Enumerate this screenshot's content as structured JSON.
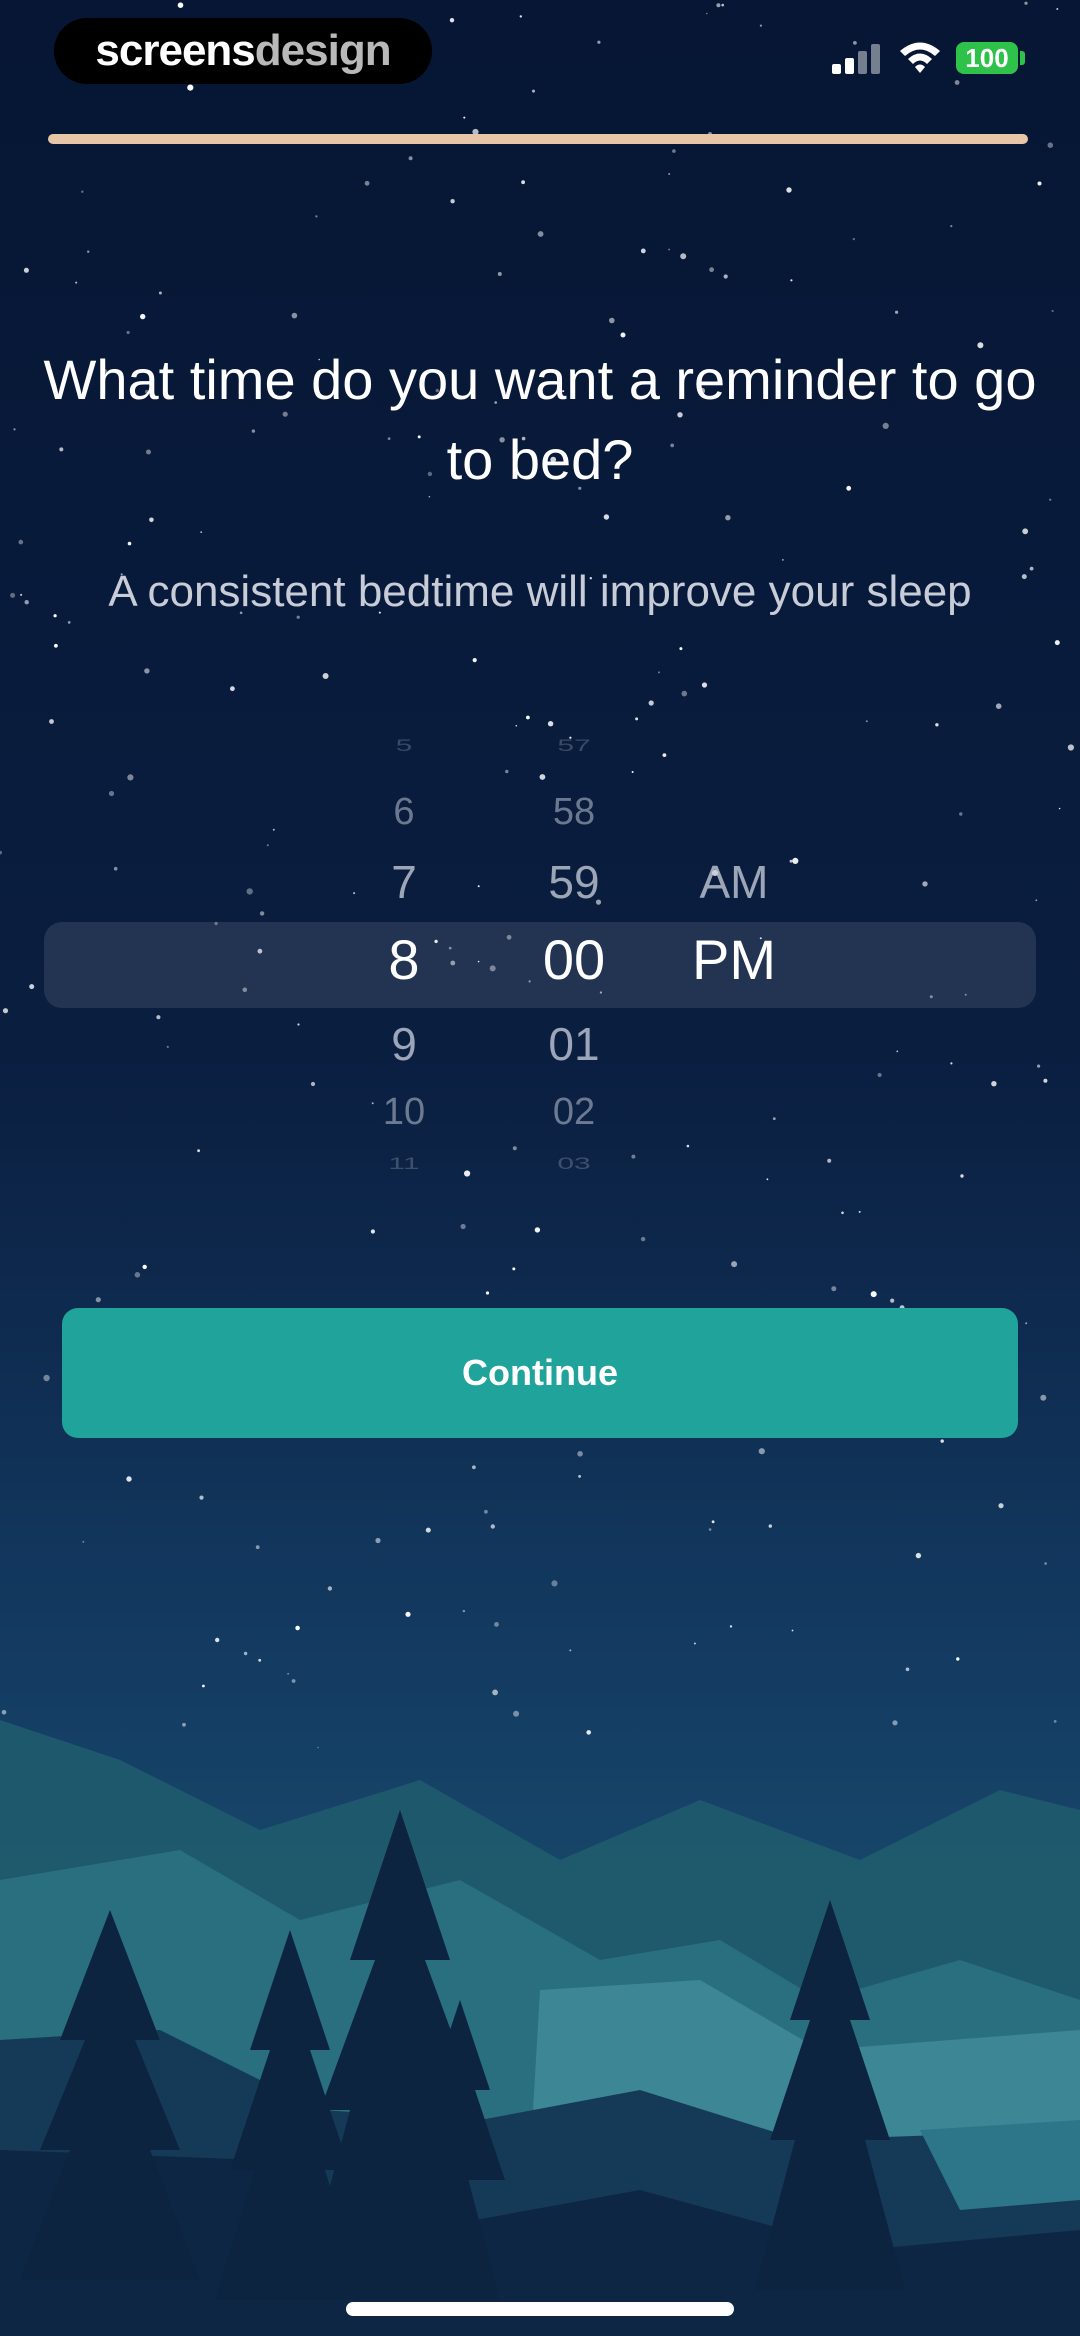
{
  "status_bar": {
    "brand_part1": "screens",
    "brand_part2": "design",
    "battery": "100"
  },
  "onboarding": {
    "progress_fraction": 1.0
  },
  "question": "What time do you want a reminder to go to bed?",
  "subtitle": "A consistent bedtime will improve your sleep",
  "picker": {
    "hours": [
      "5",
      "6",
      "7",
      "8",
      "9",
      "10",
      "11"
    ],
    "minutes": [
      "57",
      "58",
      "59",
      "00",
      "01",
      "02",
      "03"
    ],
    "periods": [
      "AM",
      "PM"
    ],
    "selected": {
      "hour": "8",
      "minute": "00",
      "period": "PM"
    }
  },
  "continue_label": "Continue",
  "colors": {
    "accent": "#1fa39a",
    "progress": "#e7c6a8",
    "sky_top": "#061634",
    "sky_bottom": "#1d5f78"
  }
}
